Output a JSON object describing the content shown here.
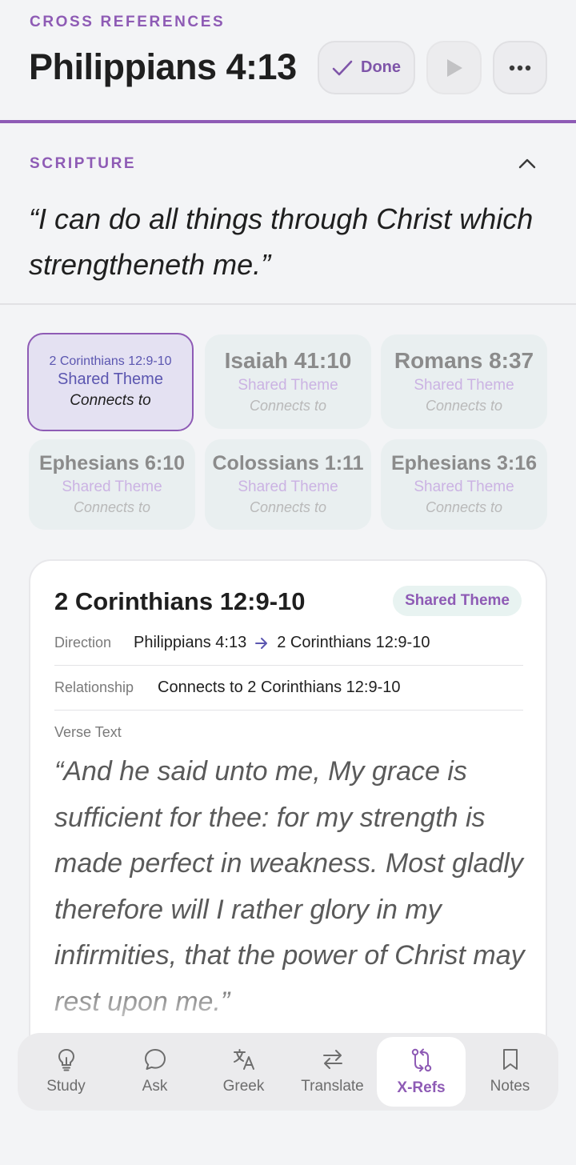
{
  "header": {
    "eyebrow": "CROSS REFERENCES",
    "title": "Philippians 4:13",
    "done_label": "Done"
  },
  "scripture": {
    "label": "SCRIPTURE",
    "text": "“I can do all things through Christ which strengtheneth me.”"
  },
  "references": [
    {
      "title": "2 Corinthians 12:9-10",
      "theme": "Shared Theme",
      "relation": "Connects to",
      "selected": true
    },
    {
      "title": "Isaiah 41:10",
      "theme": "Shared Theme",
      "relation": "Connects to",
      "selected": false
    },
    {
      "title": "Romans 8:37",
      "theme": "Shared Theme",
      "relation": "Connects to",
      "selected": false
    },
    {
      "title": "Ephesians 6:10",
      "theme": "Shared Theme",
      "relation": "Connects to",
      "selected": false
    },
    {
      "title": "Colossians 1:11",
      "theme": "Shared Theme",
      "relation": "Connects to",
      "selected": false
    },
    {
      "title": "Ephesians 3:16",
      "theme": "Shared Theme",
      "relation": "Connects to",
      "selected": false
    }
  ],
  "detail": {
    "title": "2 Corinthians 12:9-10",
    "badge": "Shared Theme",
    "direction_label": "Direction",
    "direction_from": "Philippians 4:13",
    "direction_to": "2 Corinthians 12:9-10",
    "relationship_label": "Relationship",
    "relationship_value": "Connects to 2 Corinthians 12:9-10",
    "verse_label": "Verse Text",
    "verse_text": "“And he said unto me, My grace is sufficient for thee: for my strength is made perfect in weakness. Most gladly therefore will I rather glory in my infirmities, that the power of Christ may rest upon me.”"
  },
  "tabs": [
    {
      "label": "Study",
      "icon": "lightbulb-icon"
    },
    {
      "label": "Ask",
      "icon": "chat-bubble-icon"
    },
    {
      "label": "Greek",
      "icon": "translate-icon"
    },
    {
      "label": "Translate",
      "icon": "swap-arrows-icon"
    },
    {
      "label": "X-Refs",
      "icon": "cross-reference-icon",
      "active": true
    },
    {
      "label": "Notes",
      "icon": "bookmark-icon"
    }
  ],
  "colors": {
    "accent": "#8e5bb5",
    "indigo": "#5b56b0",
    "badge_bg": "#e8f3f1",
    "tile_bg": "#e9eff0"
  }
}
